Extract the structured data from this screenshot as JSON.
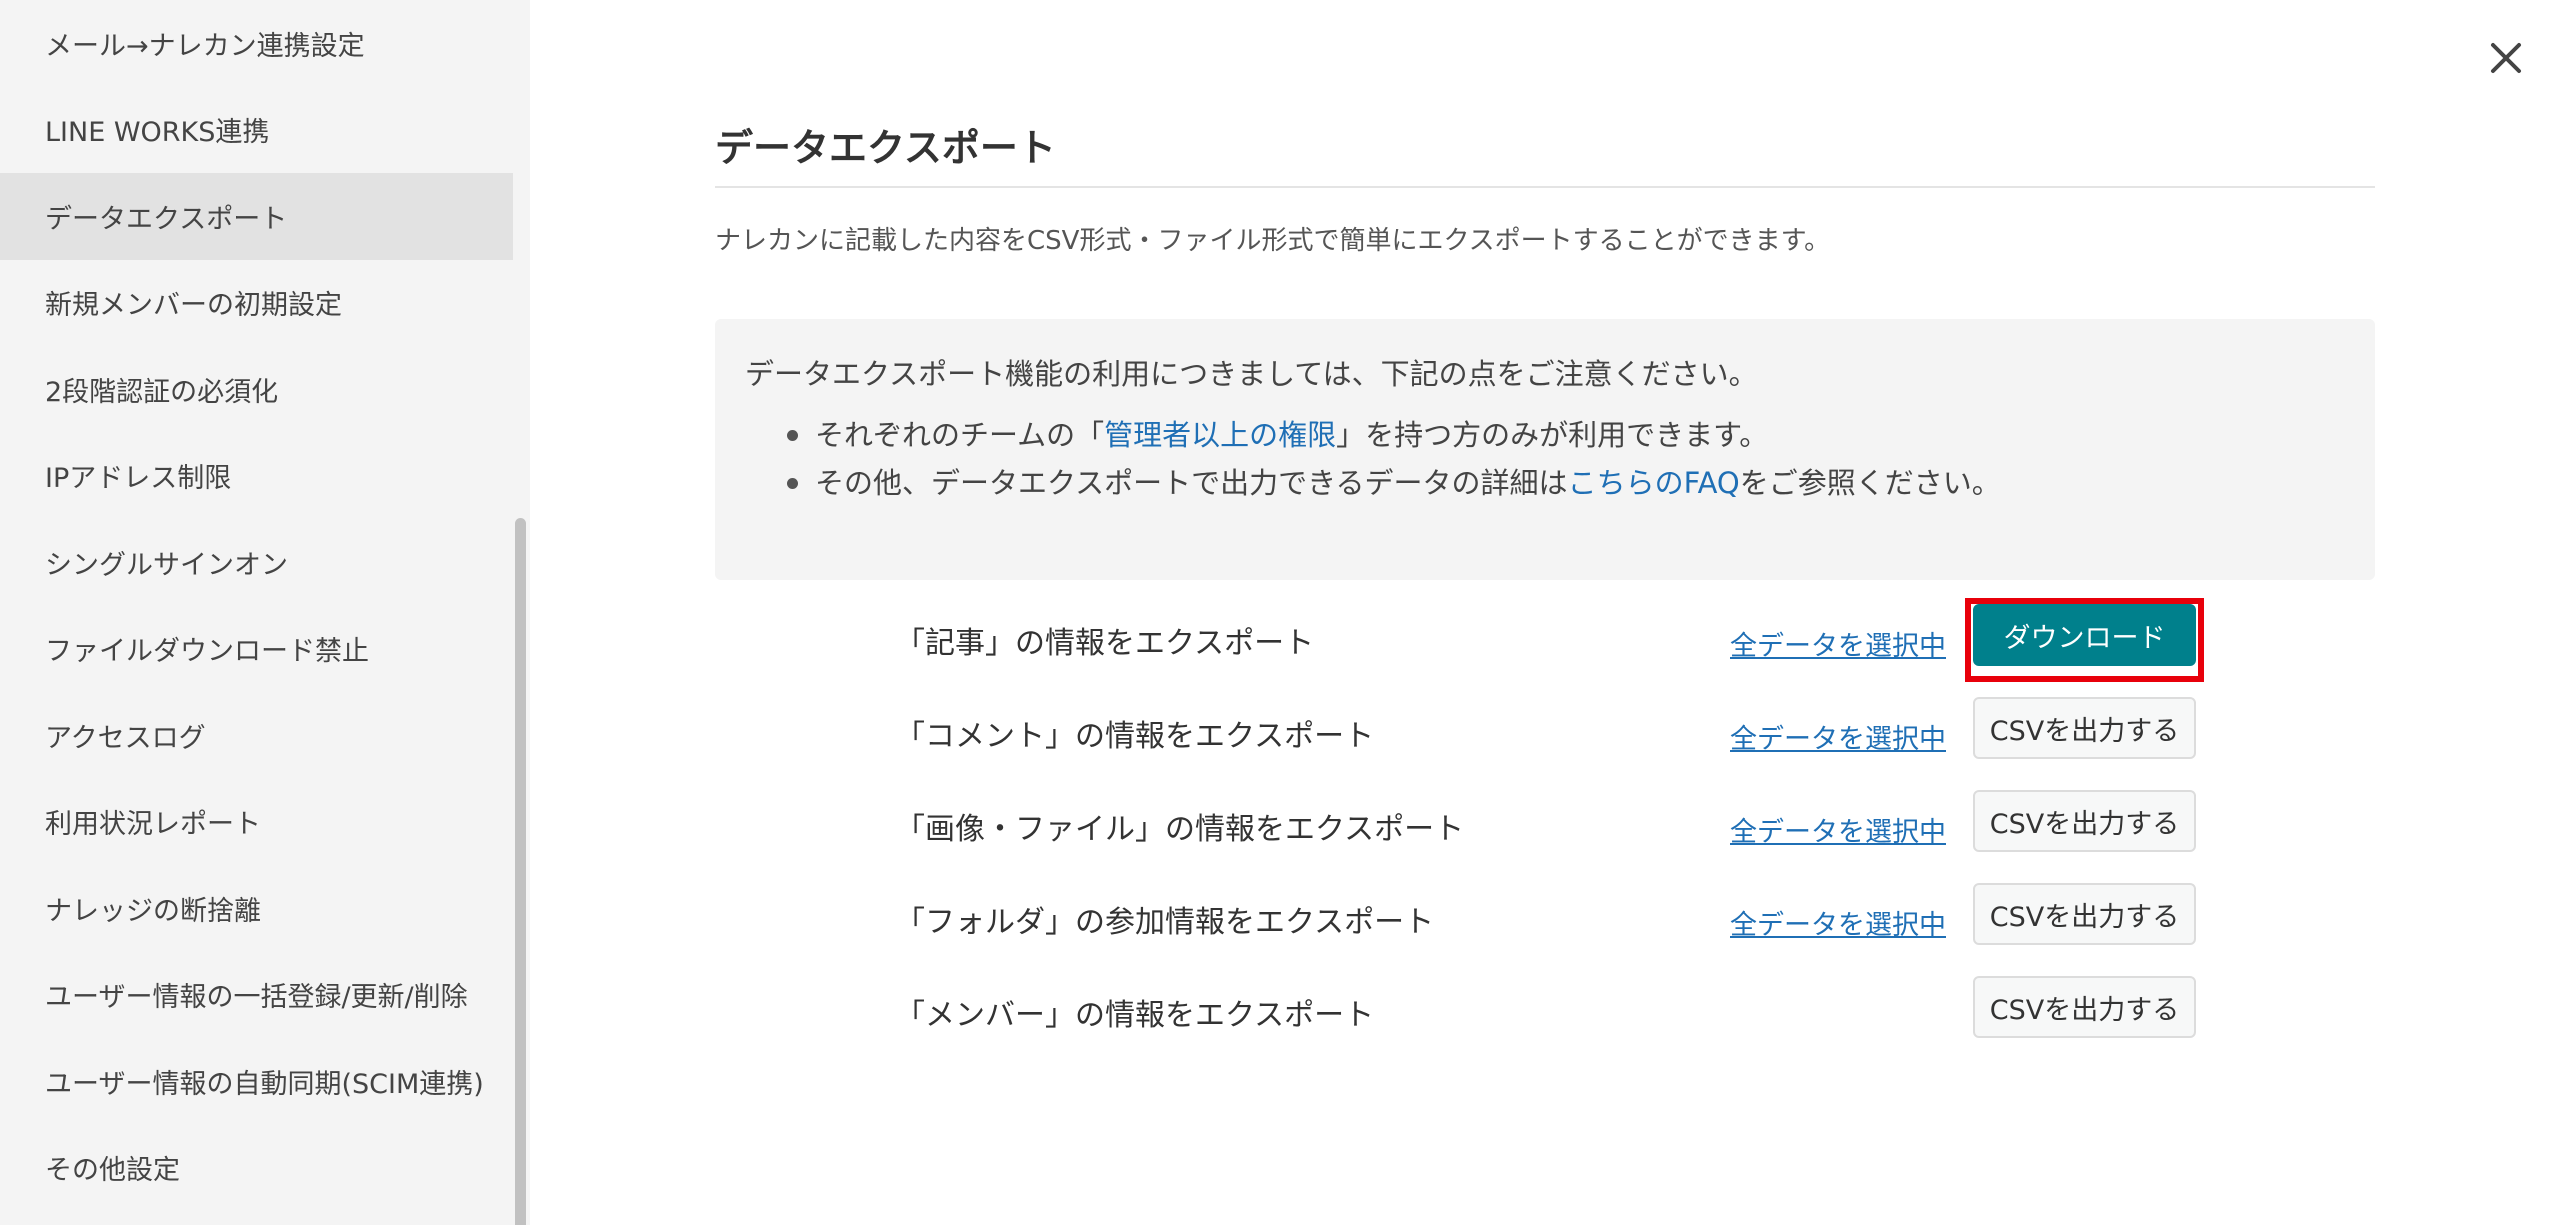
{
  "sidebar": {
    "items": [
      {
        "label": "メール→ナレカン連携設定",
        "active": false
      },
      {
        "label": "LINE WORKS連携",
        "active": false
      },
      {
        "label": "データエクスポート",
        "active": true
      },
      {
        "label": "新規メンバーの初期設定",
        "active": false
      },
      {
        "label": "2段階認証の必須化",
        "active": false
      },
      {
        "label": "IPアドレス制限",
        "active": false
      },
      {
        "label": "シングルサインオン",
        "active": false
      },
      {
        "label": "ファイルダウンロード禁止",
        "active": false
      },
      {
        "label": "アクセスログ",
        "active": false
      },
      {
        "label": "利用状況レポート",
        "active": false
      },
      {
        "label": "ナレッジの断捨離",
        "active": false
      },
      {
        "label": "ユーザー情報の一括登録/更新/削除",
        "active": false
      },
      {
        "label": "ユーザー情報の自動同期(SCIM連携)",
        "active": false
      },
      {
        "label": "その他設定",
        "active": false
      }
    ]
  },
  "icons": {
    "close": "close-icon",
    "bullet": "bullet-dot"
  },
  "main": {
    "title": "データエクスポート",
    "description": "ナレカンに記載した内容をCSV形式・ファイル形式で簡単にエクスポートすることができます。",
    "notice": {
      "heading": "データエクスポート機能の利用につきましては、下記の点をご注意ください。",
      "item1": {
        "before": "それぞれのチームの「",
        "link": "管理者以上の権限",
        "after": "」を持つ方のみが利用できます。"
      },
      "item2": {
        "before": "その他、データエクスポートで出力できるデータの詳細は",
        "link": "こちらのFAQ",
        "after": "をご参照ください。"
      }
    },
    "exports": [
      {
        "label": "「記事」の情報をエクスポート",
        "select": "全データを選択中",
        "button": "ダウンロード",
        "primary": true,
        "highlighted": true
      },
      {
        "label": "「コメント」の情報をエクスポート",
        "select": "全データを選択中",
        "button": "CSVを出力する",
        "primary": false,
        "highlighted": false
      },
      {
        "label": "「画像・ファイル」の情報をエクスポート",
        "select": "全データを選択中",
        "button": "CSVを出力する",
        "primary": false,
        "highlighted": false
      },
      {
        "label": "「フォルダ」の参加情報をエクスポート",
        "select": "全データを選択中",
        "button": "CSVを出力する",
        "primary": false,
        "highlighted": false
      },
      {
        "label": "「メンバー」の情報をエクスポート",
        "select": "",
        "button": "CSVを出力する",
        "primary": false,
        "highlighted": false
      }
    ]
  },
  "colors": {
    "primary": "#00808c",
    "link": "#1f6fb5",
    "highlight": "#e8000b",
    "sidebar_bg": "#f4f4f4",
    "sidebar_active": "#e2e2e2"
  }
}
